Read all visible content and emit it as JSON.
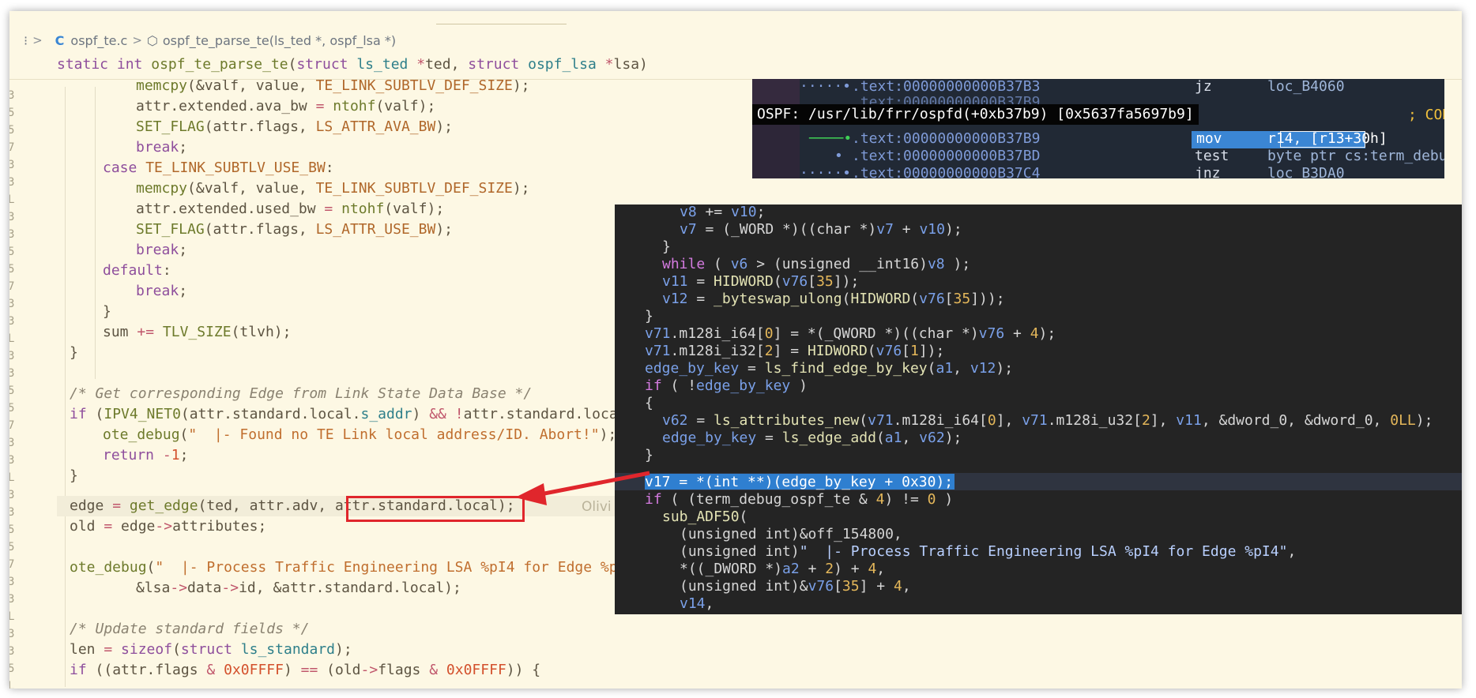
{
  "breadcrumb": {
    "gutter_glyph": "⁝",
    "sep": ">",
    "file_icon": "c-file-icon",
    "file_icon_glyph": "C",
    "file": "ospf_te.c",
    "symbol_icon": "cube-icon",
    "symbol_icon_glyph": "⬡",
    "symbol": "ospf_te_parse_te(ls_ted *, ospf_lsa *)"
  },
  "ida_view": {
    "tooltip": "OSPF: /usr/lib/frr/ospfd(+0xb37b9) [0x5637fa5697b9]",
    "rows": [
      {
        "addr": ".text:00000000000B37B3",
        "mnem": "jz",
        "arg": "loc_B4060"
      },
      {
        "addr": ".text:00000000000B37B9",
        "mnem": "",
        "arg": ""
      },
      {
        "addr": ".text:00000000000B37B9",
        "mnem": "mov",
        "arg": "r14, [r13+30h]"
      },
      {
        "addr": ".text:00000000000B37BD",
        "mnem": "test",
        "arg": "byte ptr cs:term_debu"
      },
      {
        "addr": ".text:00000000000B37C4",
        "mnem": "jnz",
        "arg": "loc_B3DA0"
      }
    ],
    "comment": "; COD"
  },
  "ghost_text": "Olivi",
  "colors": {
    "highlight_box": "#e0262c",
    "editor_bg": "#fdf8e4",
    "pseudo_bg": "#242424",
    "ida_bg": "#212935"
  }
}
